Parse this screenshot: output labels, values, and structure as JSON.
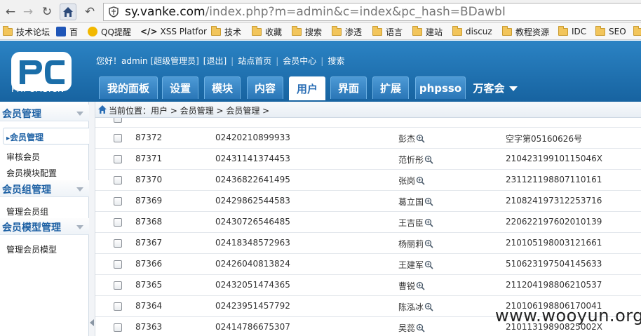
{
  "browser": {
    "url_host": "sy.vanke.com",
    "url_rest": "/index.php?m=admin&c=index&pc_hash=BDawbI",
    "bookmarks": [
      "技术论坛",
      "百",
      "QQ提醒",
      "XSS Platfor",
      "技术",
      "收藏",
      "搜索",
      "渗透",
      "语言",
      "建站",
      "discuz",
      "教程资源",
      "IDC",
      "SEO"
    ]
  },
  "header": {
    "logo_text": "PHPCMS.CN",
    "greeting": "您好！admin [超级管理员]",
    "logout": "[退出]",
    "site_home": "站点首页",
    "member_center": "会员中心",
    "search": "搜索",
    "tabs": [
      "我的面板",
      "设置",
      "模块",
      "内容",
      "用户",
      "界面",
      "扩展",
      "phpsso",
      "万客会"
    ]
  },
  "sidebar": {
    "group1": "会员管理",
    "group1_items": [
      "会员管理",
      "审核会员",
      "会员模块配置"
    ],
    "group2": "会员组管理",
    "group2_items": [
      "管理会员组"
    ],
    "group3": "会员模型管理",
    "group3_items": [
      "管理会员模型"
    ]
  },
  "breadcrumb": "当前位置：用户 > 会员管理 > 会员管理 >",
  "rows": [
    {
      "id": "87372",
      "phone": "02420210899933",
      "name": "彭杰",
      "idno": "空字第05160626号"
    },
    {
      "id": "87371",
      "phone": "02431141374453",
      "name": "范忻彤",
      "idno": "21042319910115046X"
    },
    {
      "id": "87370",
      "phone": "02436822641495",
      "name": "张岗",
      "idno": "231121198807110161"
    },
    {
      "id": "87369",
      "phone": "02429862544583",
      "name": "葛立国",
      "idno": "210824197312253716"
    },
    {
      "id": "87368",
      "phone": "02430726546485",
      "name": "王吉臣",
      "idno": "220622197602010139"
    },
    {
      "id": "87367",
      "phone": "02418348572963",
      "name": "杨丽莉",
      "idno": "210105198003121661"
    },
    {
      "id": "87366",
      "phone": "02426040813824",
      "name": "王建军",
      "idno": "510623197504145633"
    },
    {
      "id": "87365",
      "phone": "02432051474365",
      "name": "曹锐",
      "idno": "211204198806210537"
    },
    {
      "id": "87364",
      "phone": "02423951457792",
      "name": "陈泓冰",
      "idno": "210106198806170041"
    },
    {
      "id": "87363",
      "phone": "02414786675307",
      "name": "吴蕊",
      "idno": "21011319890825002X"
    }
  ],
  "watermark": "www.wooyun.org",
  "colors": {
    "header_blue": "#1b6ea9",
    "accent": "#1b5fa3"
  }
}
